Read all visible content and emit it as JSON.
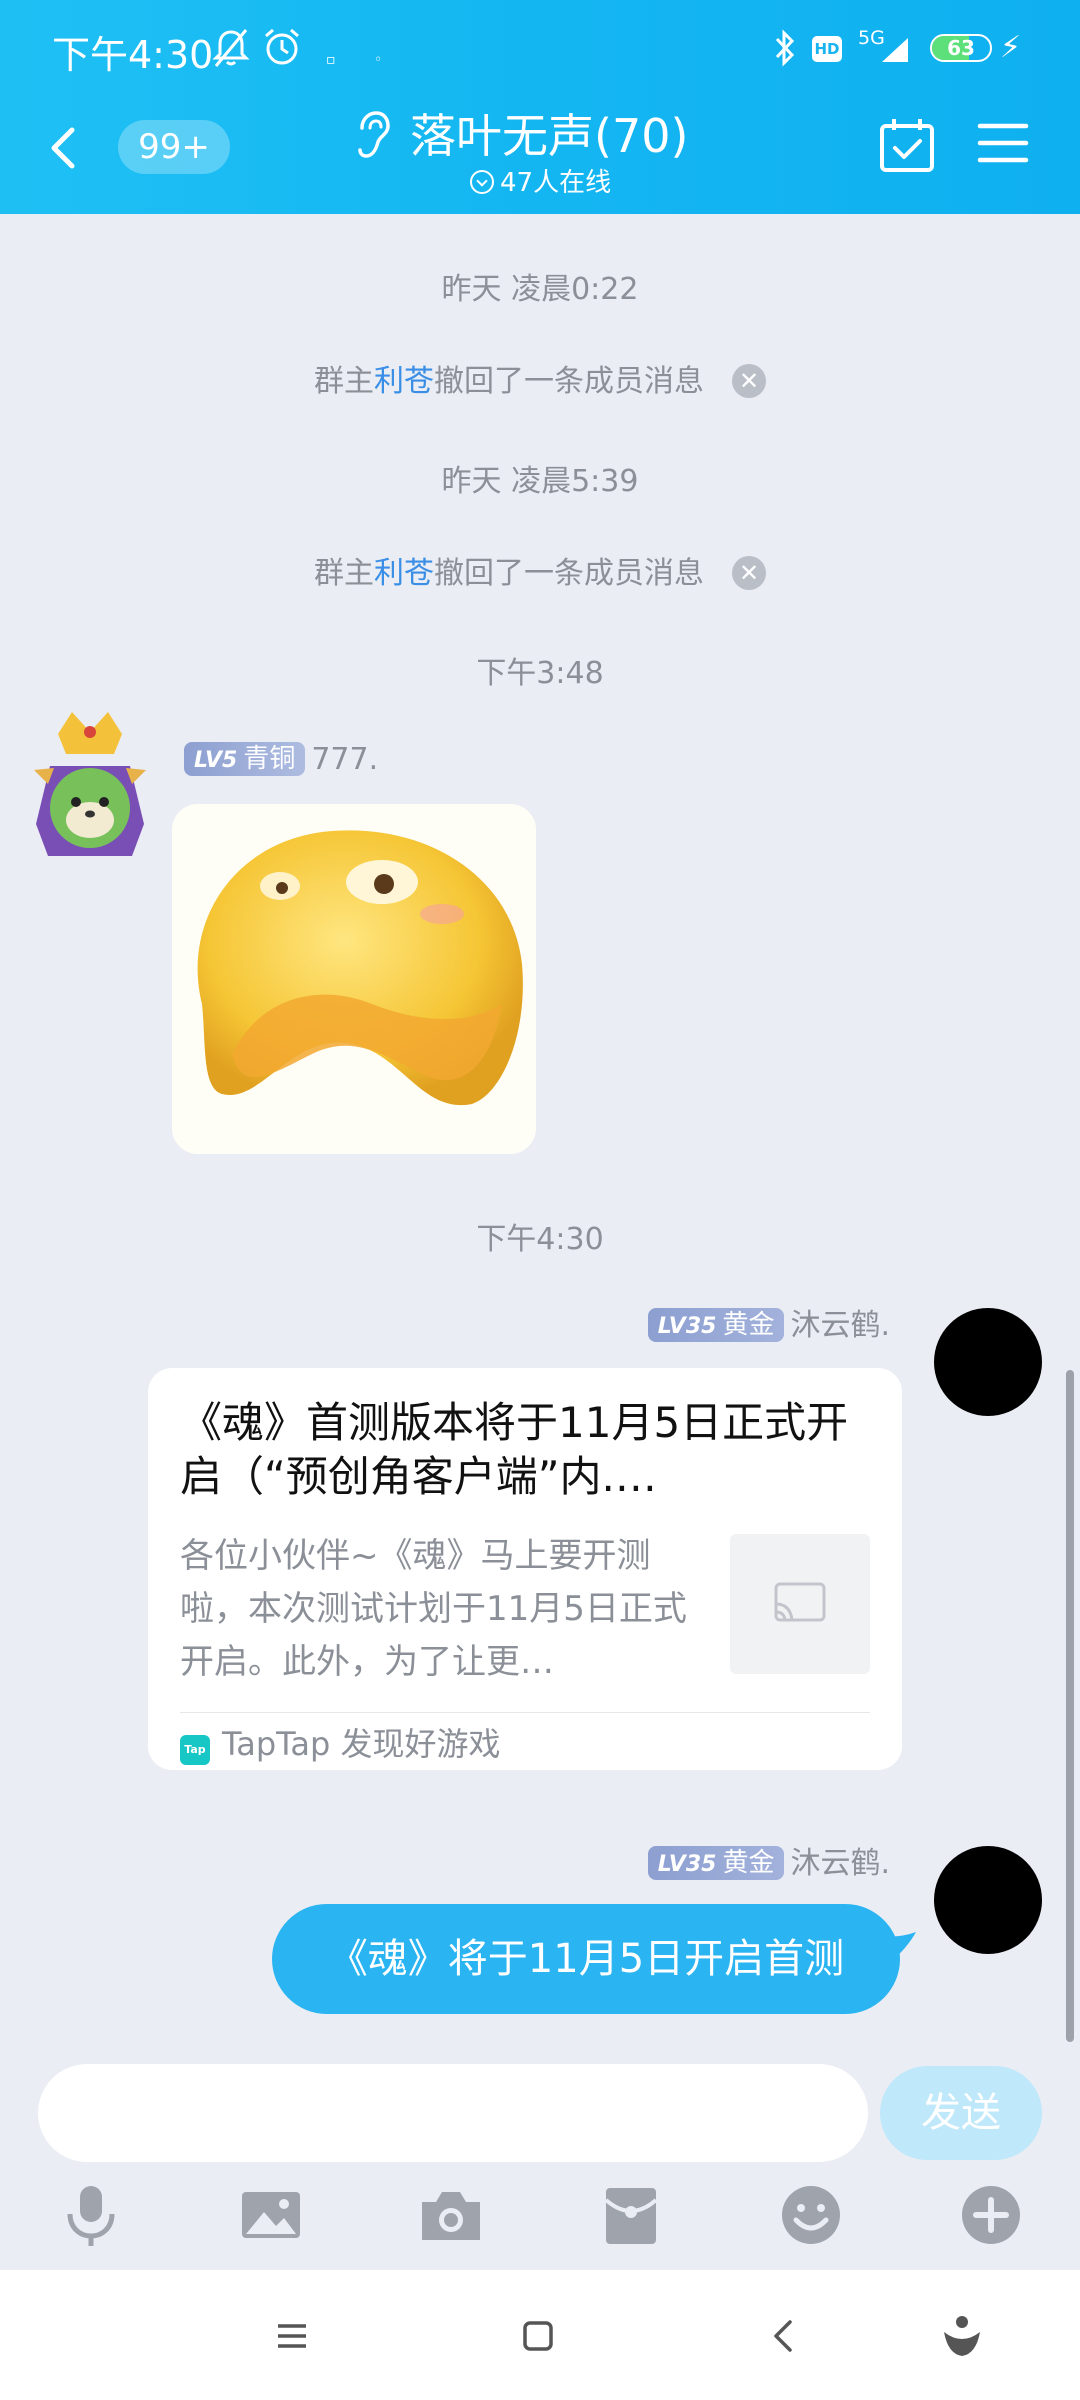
{
  "status_bar": {
    "time": "下午4:30",
    "network": "5G",
    "hd": "HD",
    "battery": "63",
    "battery_level": 0.63
  },
  "header": {
    "unread": "99+",
    "title": "落叶无声(70)",
    "online": "47人在线",
    "icons": [
      "back-icon",
      "ear-icon",
      "calendar-check-icon",
      "menu-icon"
    ]
  },
  "messages": {
    "time1": "昨天 凌晨0:22",
    "sys1": {
      "prefix": "群主",
      "name": "利苍",
      "suffix": "撤回了一条成员消息",
      "close": "✕"
    },
    "time2": "昨天 凌晨5:39",
    "sys2": {
      "prefix": "群主",
      "name": "利苍",
      "suffix": "撤回了一条成员消息",
      "close": "✕"
    },
    "time3": "下午3:48",
    "msg1": {
      "lv": "LV5",
      "rank": "青铜",
      "name": "777."
    },
    "time4": "下午4:30",
    "msg2": {
      "lv": "LV35",
      "rank": "黄金",
      "name": "沐云鹤.",
      "card_title": "《魂》首测版本将于11月5日正式开启（“预创角客户端”内.…",
      "card_desc": "各位小伙伴~《魂》马上要开测啦，本次测试计划于11月5日正式开启。此外，为了让更…",
      "source_icon": "Tap",
      "source": "TapTap 发现好游戏"
    },
    "msg3": {
      "lv": "LV35",
      "rank": "黄金",
      "name": "沐云鹤.",
      "text": "《魂》将于11月5日开启首测"
    }
  },
  "input": {
    "value": "",
    "send_label": "发送",
    "tools": [
      "microphone-icon",
      "image-icon",
      "camera-icon",
      "red-packet-icon",
      "emoji-icon",
      "plus-icon"
    ]
  },
  "navbar": {
    "icons": [
      "menu-lines-icon",
      "home-square-icon",
      "back-chevron-icon",
      "assistant-icon"
    ]
  },
  "colors": {
    "header": "#14b6f2",
    "bubble": "#2ab4f2",
    "link": "#3a8ee6",
    "background": "#eaedf4"
  }
}
